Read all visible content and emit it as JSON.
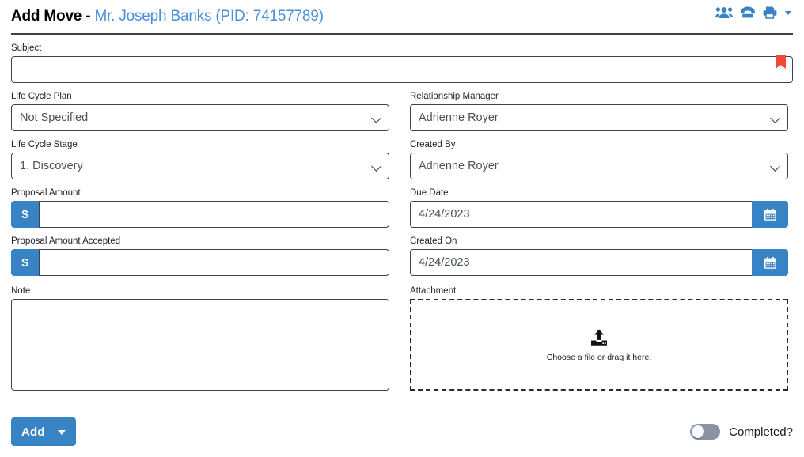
{
  "header": {
    "title_prefix": "Add Move - ",
    "subject_name": "Mr. Joseph Banks (PID: 74157789)",
    "icons": [
      {
        "name": "people-group-icon"
      },
      {
        "name": "telephone-icon"
      },
      {
        "name": "printer-icon"
      },
      {
        "name": "chevron-down-icon"
      }
    ],
    "accent_color": "#3883c4",
    "link_color": "#4a90d9"
  },
  "form": {
    "subject": {
      "label": "Subject",
      "value": "",
      "placeholder": "",
      "required_flag_color": "#ef4a38"
    },
    "life_cycle_plan": {
      "label": "Life Cycle Plan",
      "value": "Not Specified",
      "options": [
        "Not Specified"
      ]
    },
    "life_cycle_stage": {
      "label": "Life Cycle Stage",
      "value": "1. Discovery",
      "options": [
        "1. Discovery"
      ]
    },
    "proposal_amount": {
      "label": "Proposal Amount",
      "prefix": "$",
      "value": "",
      "placeholder": ""
    },
    "proposal_amount_accepted": {
      "label": "Proposal Amount Accepted",
      "prefix": "$",
      "value": "",
      "placeholder": ""
    },
    "relationship_manager": {
      "label": "Relationship Manager",
      "value": "Adrienne Royer",
      "options": [
        "Adrienne Royer"
      ]
    },
    "created_by": {
      "label": "Created By",
      "value": "Adrienne Royer",
      "options": [
        "Adrienne Royer"
      ]
    },
    "due_date": {
      "label": "Due Date",
      "value": "4/24/2023",
      "button_icon": "calendar-icon"
    },
    "created_on": {
      "label": "Created On",
      "value": "4/24/2023",
      "button_icon": "calendar-icon"
    },
    "note": {
      "label": "Note",
      "value": "",
      "placeholder": ""
    },
    "attachment": {
      "label": "Attachment",
      "dropzone_text": "Choose a file or drag it here.",
      "icon": "upload-icon"
    }
  },
  "footer": {
    "add_label": "Add",
    "completed_label": "Completed?",
    "completed_on": false
  }
}
